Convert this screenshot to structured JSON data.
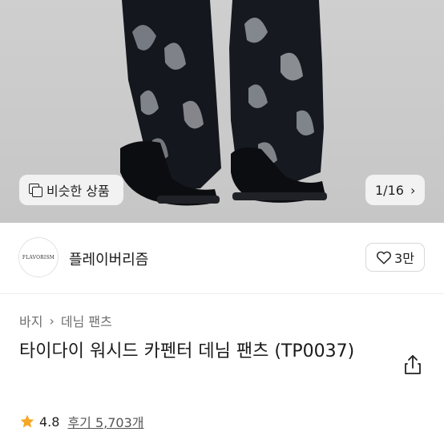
{
  "gallery": {
    "similar_label": "비슷한 상품",
    "counter": "1/16",
    "similar_icon": "copy-icon",
    "next_icon": "chevron-right-icon"
  },
  "brand": {
    "logo_text": "FLAVORISM",
    "name": "플레이버리즘",
    "like_count": "3만",
    "like_icon": "heart-outline-icon"
  },
  "product": {
    "breadcrumb": [
      "바지",
      "데님 팬츠"
    ],
    "title": "타이다이 워시드 카펜터 데님 팬츠 (TP0037)",
    "rating": "4.8",
    "review_label": "후기 5,703개",
    "share_icon": "share-icon"
  },
  "colors": {
    "background": "#ffffff",
    "star": "#f5a623",
    "muted_text": "#707070"
  }
}
